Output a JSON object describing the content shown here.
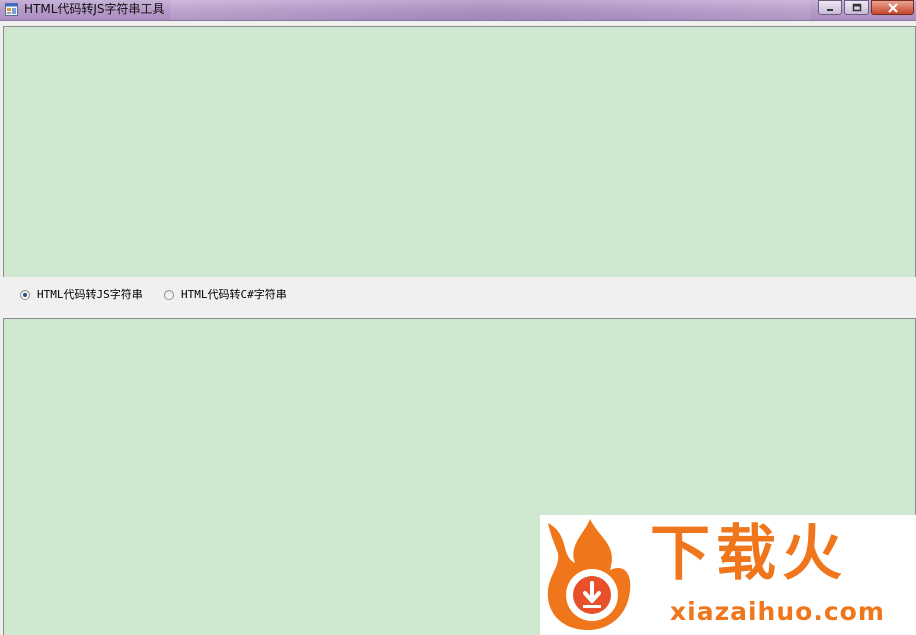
{
  "window": {
    "title": "HTML代码转JS字符串工具",
    "controls": [
      "minimize-icon",
      "maximize-icon",
      "close-icon"
    ]
  },
  "editors": {
    "input_value": "",
    "output_value": "",
    "background_color": "#cfe8cf"
  },
  "options": [
    {
      "label": "HTML代码转JS字符串",
      "checked": true
    },
    {
      "label": "HTML代码转C#字符串",
      "checked": false
    }
  ],
  "watermark": {
    "logo_text": "下载火",
    "url": "xiazaihuo.com",
    "brand_color": "#f0761c"
  }
}
